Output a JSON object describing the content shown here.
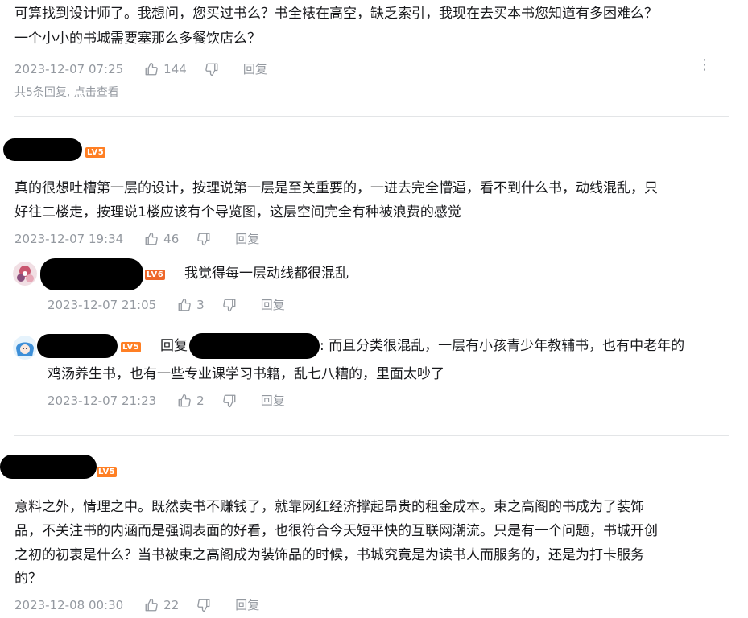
{
  "comment0": {
    "lines": [
      "可算找到设计师了。我想问，您买过书么？书全裱在高空，缺乏索引，我现在去买本书您知道有多困难么？",
      "一个小小的书城需要塞那么多餐饮店么？"
    ],
    "time": "2023-12-07 07:25",
    "likes": "144",
    "reply_label": "回复",
    "sub_reply_info": "共5条回复, 点击查看",
    "more_icon": "⋮"
  },
  "comment1": {
    "level": "LV5",
    "lines": [
      "真的很想吐槽第一层的设计，按理说第一层是至关重要的，一进去完全懵逼，看不到什么书，动线混乱，只",
      "好往二楼走，按理说1楼应该有个导览图，这层空间完全有种被浪费的感觉"
    ],
    "time": "2023-12-07 19:34",
    "likes": "46",
    "reply_label": "回复",
    "replies": [
      {
        "level": "LV6",
        "text": "我觉得每一层动线都很混乱",
        "time": "2023-12-07 21:05",
        "likes": "3",
        "reply_label": "回复"
      },
      {
        "level": "LV5",
        "reply_prefix": "回复",
        "line1_rest": ": 而且分类很混乱，一层有小孩青少年教辅书，也有中老年的",
        "line2": "鸡汤养生书，也有一些专业课学习书籍，乱七八糟的，里面太吵了",
        "time": "2023-12-07 21:23",
        "likes": "2",
        "reply_label": "回复"
      }
    ]
  },
  "comment2": {
    "level": "LV5",
    "lines": [
      "意料之外，情理之中。既然卖书不赚钱了，就靠网红经济撑起昂贵的租金成本。束之高阁的书成为了装饰",
      "品，不关注书的内涵而是强调表面的好看，也很符合今天短平快的互联网潮流。只是有一个问题，书城开创",
      "之初的初衷是什么？当书被束之高阁成为装饰品的时候，书城究竟是为读书人而服务的，还是为打卡服务",
      "的？"
    ],
    "time": "2023-12-08 00:30",
    "likes": "22",
    "reply_label": "回复"
  },
  "icons": {
    "like": "thumbs-up-icon",
    "dislike": "thumbs-down-icon",
    "more": "more-vertical-icon"
  },
  "colors": {
    "text": "#18191c",
    "meta": "#9499a0",
    "level_badge": "#ff7f24",
    "divider": "#e3e5e7"
  }
}
